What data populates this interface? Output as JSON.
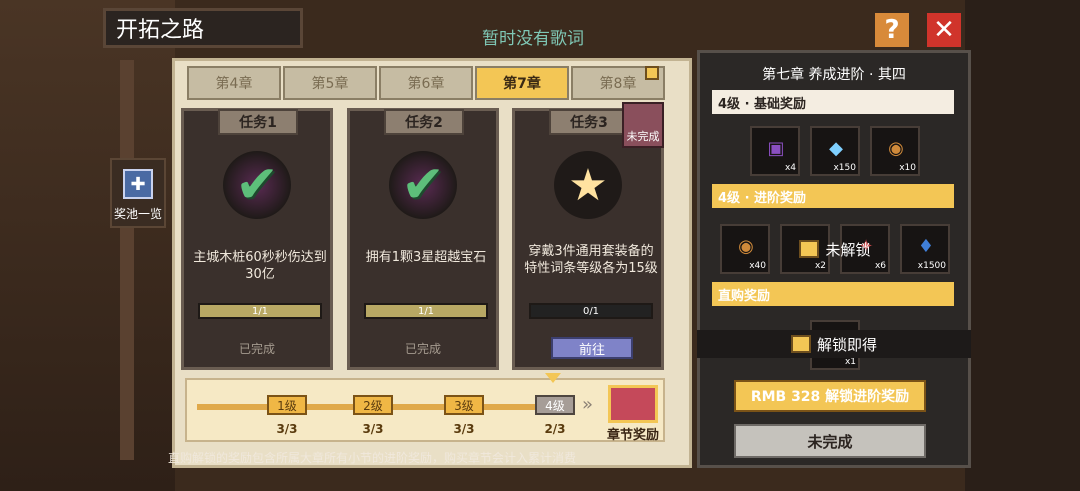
{
  "title": "开拓之路",
  "subtitle": "暂时没有歌词",
  "top_buttons": {
    "help_label": "?",
    "close_label": "✕"
  },
  "pool": {
    "label": "奖池一览"
  },
  "chapters": [
    {
      "label": "第4章",
      "active": false
    },
    {
      "label": "第5章",
      "active": false
    },
    {
      "label": "第6章",
      "active": false
    },
    {
      "label": "第7章",
      "active": true
    },
    {
      "label": "第8章",
      "active": false
    }
  ],
  "tasks": [
    {
      "head": "任务1",
      "desc": "主城木桩60秒秒伤达到30亿",
      "progress": "1/1",
      "progress_value": 1.0,
      "status": "已完成"
    },
    {
      "head": "任务2",
      "desc": "拥有1颗3星超越宝石",
      "progress": "1/1",
      "progress_value": 1.0,
      "status": "已完成"
    },
    {
      "head": "任务3",
      "desc": "穿戴3件通用套装备的特性词条等级各为15级",
      "progress": "0/1",
      "progress_value": 0.0,
      "go_label": "前往",
      "tag": "未完成"
    }
  ],
  "levels": [
    {
      "label": "1级",
      "count": "3/3"
    },
    {
      "label": "2级",
      "count": "3/3"
    },
    {
      "label": "3级",
      "count": "3/3"
    },
    {
      "label": "4级",
      "count": "2/3"
    }
  ],
  "chapter_reward_label": "章节奖励",
  "footer_note": "直购解锁的奖励包含所属大章所有小节的进阶奖励，购买章节会计入累计消费",
  "side": {
    "title": "第七章 养成进阶 · 其四",
    "basic_label": "4级 · 基础奖励",
    "basic_rewards": [
      {
        "icon": "card-icon",
        "glyph": "▣",
        "qty": "x4",
        "color": "#8a4fc1"
      },
      {
        "icon": "diamond-icon",
        "glyph": "◆",
        "qty": "x150",
        "color": "#7fd0ff"
      },
      {
        "icon": "medal-icon",
        "glyph": "◉",
        "qty": "x10",
        "color": "#d08a3a"
      }
    ],
    "advanced_label": "4级 · 进阶奖励",
    "advanced_rewards": [
      {
        "icon": "medal-icon",
        "glyph": "◉",
        "qty": "x40",
        "color": "#d08a3a"
      },
      {
        "icon": "stone-icon",
        "glyph": "▲",
        "qty": "x2",
        "color": "#b58a5a"
      },
      {
        "icon": "gem-bundle-icon",
        "glyph": "✦",
        "qty": "x6",
        "color": "#c84a4a"
      },
      {
        "icon": "heart-diamond-icon",
        "glyph": "♦",
        "qty": "x1500",
        "color": "#3f7fd9"
      }
    ],
    "locked_label": "未解锁",
    "direct_label": "直购奖励",
    "direct_rewards": [
      {
        "icon": "chest-icon",
        "glyph": "▦",
        "qty": "x1",
        "color": "#c5495a"
      }
    ],
    "unlock_label": "解锁即得",
    "rmb_button": "RMB 328 解锁进阶奖励",
    "status_button": "未完成"
  }
}
